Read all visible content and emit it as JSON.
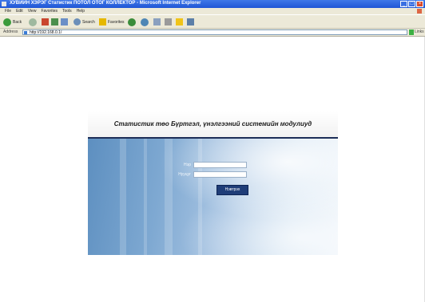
{
  "window": {
    "title": "ХУВИЙН ХЭРЭГ Статистик ПОТОЛ ОТОГ КОЛЛЕКТОР - Microsoft Internet Explorer",
    "buttons": {
      "minimize": "_",
      "maximize": "□",
      "close": "×"
    }
  },
  "menu": {
    "items": [
      "File",
      "Edit",
      "View",
      "Favorites",
      "Tools",
      "Help"
    ]
  },
  "toolbar": {
    "back_label": "Back",
    "search_label": "Search",
    "favorites_label": "Favorites"
  },
  "address": {
    "label": "Address",
    "url": "http://192.168.0.1/",
    "go_label": "Go",
    "links_label": "Links"
  },
  "login": {
    "title": "Статистик төо Бүртгэл, үнэлгээний системийн модулиуд",
    "username_label": "Нэр",
    "username_value": "",
    "password_label": "Нууцүг",
    "password_value": "",
    "submit_label": "Нэвтрэх",
    "footer": ""
  },
  "colors": {
    "titlebar": "#1f56d6",
    "chrome": "#ece9d8",
    "header_rule": "#1c2d57",
    "button": "#1f3d78"
  },
  "icons": {
    "back": "back-arrow-icon",
    "forward": "forward-arrow-icon",
    "stop": "stop-icon",
    "refresh": "refresh-icon",
    "home": "home-icon",
    "search": "search-icon",
    "favorites": "star-icon",
    "media": "media-icon",
    "history": "history-icon",
    "mail": "mail-icon",
    "print": "print-icon",
    "edit": "edit-icon",
    "messenger": "messenger-icon"
  }
}
